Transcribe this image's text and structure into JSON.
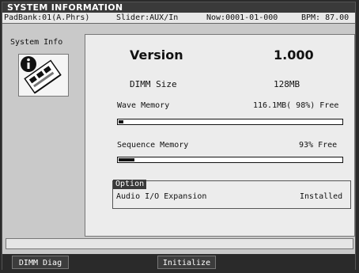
{
  "window": {
    "title": "SYSTEM INFORMATION"
  },
  "infobar": {
    "padbank": "PadBank:01(A.Phrs)",
    "slider": "Slider:AUX/In",
    "now": "Now:0001-01-000",
    "bpm": "BPM: 87.00"
  },
  "side": {
    "label": "System Info",
    "icon": "info-chip-icon"
  },
  "info": {
    "version_label": "Version",
    "version_value": "1.000",
    "dimm_label": "DIMM Size",
    "dimm_value": "128MB",
    "wave_label": "Wave Memory",
    "wave_value": "116.1MB( 98%) Free",
    "wave_used_fraction": 0.02,
    "seq_label": "Sequence Memory",
    "seq_value": "93% Free",
    "seq_used_fraction": 0.07
  },
  "option": {
    "tag": "Option",
    "label": "Audio I/O Expansion",
    "value": "Installed"
  },
  "buttons": {
    "dimm_diag": "DIMM Diag",
    "initialize": "Initialize"
  },
  "colors": {
    "dark": "#3a3a3a",
    "panel": "#ececec",
    "bg": "#c9c9c9"
  }
}
